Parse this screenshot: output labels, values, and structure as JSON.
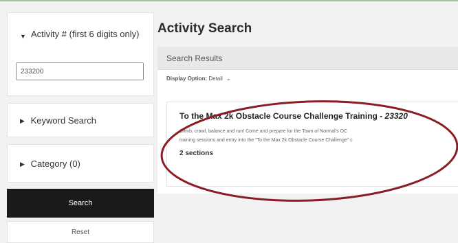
{
  "filters": {
    "activity_number": {
      "label": "Activity # (first 6 digits only)",
      "value": "233200"
    },
    "keyword": {
      "label": "Keyword Search"
    },
    "category": {
      "label": "Category (0)"
    }
  },
  "buttons": {
    "search": "Search",
    "reset": "Reset"
  },
  "main": {
    "title": "Activity Search",
    "results_header": "Search Results",
    "display_option_label": "Display Option:",
    "display_option_value": "Detail"
  },
  "result": {
    "title": "To the Max 2k Obstacle Course Challenge Training - ",
    "title_number": "23320",
    "description_line1": "Climb, crawl, balance and run! Come and prepare for the Town of Normal's OC",
    "description_line2": "training sessions and entry into the \"To the Max 2k Obstacle Course Challenge\" c",
    "sections": "2 sections"
  },
  "colors": {
    "annotation": "#8b1e25",
    "search_button": "#1a1a1a",
    "top_accent": "#9cc49a"
  }
}
